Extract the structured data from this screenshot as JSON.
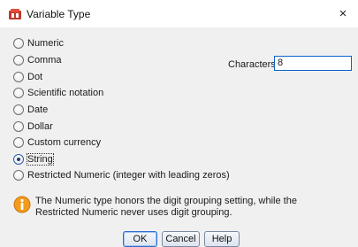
{
  "window": {
    "title": "Variable Type",
    "close_glyph": "×",
    "icon": "spss-app-icon"
  },
  "options": [
    {
      "label": "Numeric",
      "checked": false
    },
    {
      "label": "Comma",
      "checked": false
    },
    {
      "label": "Dot",
      "checked": false
    },
    {
      "label": "Scientific notation",
      "checked": false
    },
    {
      "label": "Date",
      "checked": false
    },
    {
      "label": "Dollar",
      "checked": false
    },
    {
      "label": "Custom currency",
      "checked": false
    },
    {
      "label": "String",
      "checked": true
    },
    {
      "label": "Restricted Numeric (integer with leading zeros)",
      "checked": false
    }
  ],
  "characters": {
    "label": "Characters:",
    "value": "8"
  },
  "info": {
    "icon": "info-icon",
    "text": "The Numeric type honors the digit grouping setting, while the Restricted Numeric never uses digit grouping."
  },
  "buttons": {
    "ok": "OK",
    "cancel": "Cancel",
    "help": "Help"
  },
  "colors": {
    "dialog_bg": "#f0f0f0",
    "focus_border": "#0a64c8",
    "info_orange": "#f29a1c"
  }
}
